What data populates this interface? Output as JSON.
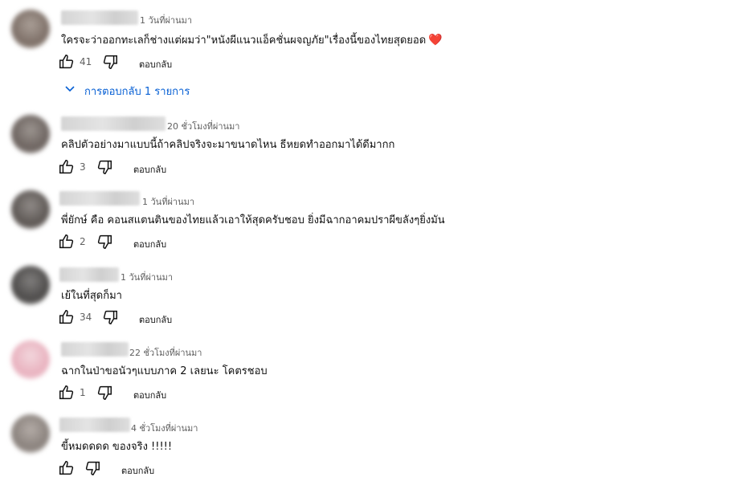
{
  "colors": {
    "link": "#065fd4",
    "heart": "#e0242f",
    "meta": "#606060"
  },
  "comments": [
    {
      "time": "1 วันที่ผ่านมา",
      "text": "ใครจะว่าออกทะเลก็ช่างแต่ผมว่า\"หนังผีแนวแอ็คชั่นผจญภัย\"เรื่องนี้ของไทยสุดยอด",
      "emoji": "❤️",
      "likes": "41",
      "reply": "ตอบกลับ"
    },
    {
      "time": "20 ชั่วโมงที่ผ่านมา",
      "text": "คลิปตัวอย่างมาแบบนี้ถ้าคลิปจริงจะมาขนาดไหน ธีหยดทำออกมาได้ดีมากก",
      "likes": "3",
      "reply": "ตอบกลับ"
    },
    {
      "time": "1 วันที่ผ่านมา",
      "text": "พี่ยักษ์ คือ คอนสแตนตินของไทยแล้วเอาให้สุดครับชอบ ยิ่งมีฉากอาคมปราผีขลังๆยิ่งมัน",
      "likes": "2",
      "reply": "ตอบกลับ"
    },
    {
      "time": "1 วันที่ผ่านมา",
      "text": "เย้ในที่สุดก็มา",
      "likes": "34",
      "reply": "ตอบกลับ"
    },
    {
      "time": "22 ชั่วโมงที่ผ่านมา",
      "text": "ฉากในป่าขอนัวๆแบบภาค 2 เลยนะ โคตรชอบ",
      "likes": "1",
      "reply": "ตอบกลับ"
    },
    {
      "time": "4 ชั่วโมงที่ผ่านมา",
      "text": "ขี้หมดดดด ของจริง !!!!!",
      "likes": "",
      "reply": "ตอบกลับ"
    }
  ],
  "replies_toggle": "การตอบกลับ 1 รายการ"
}
